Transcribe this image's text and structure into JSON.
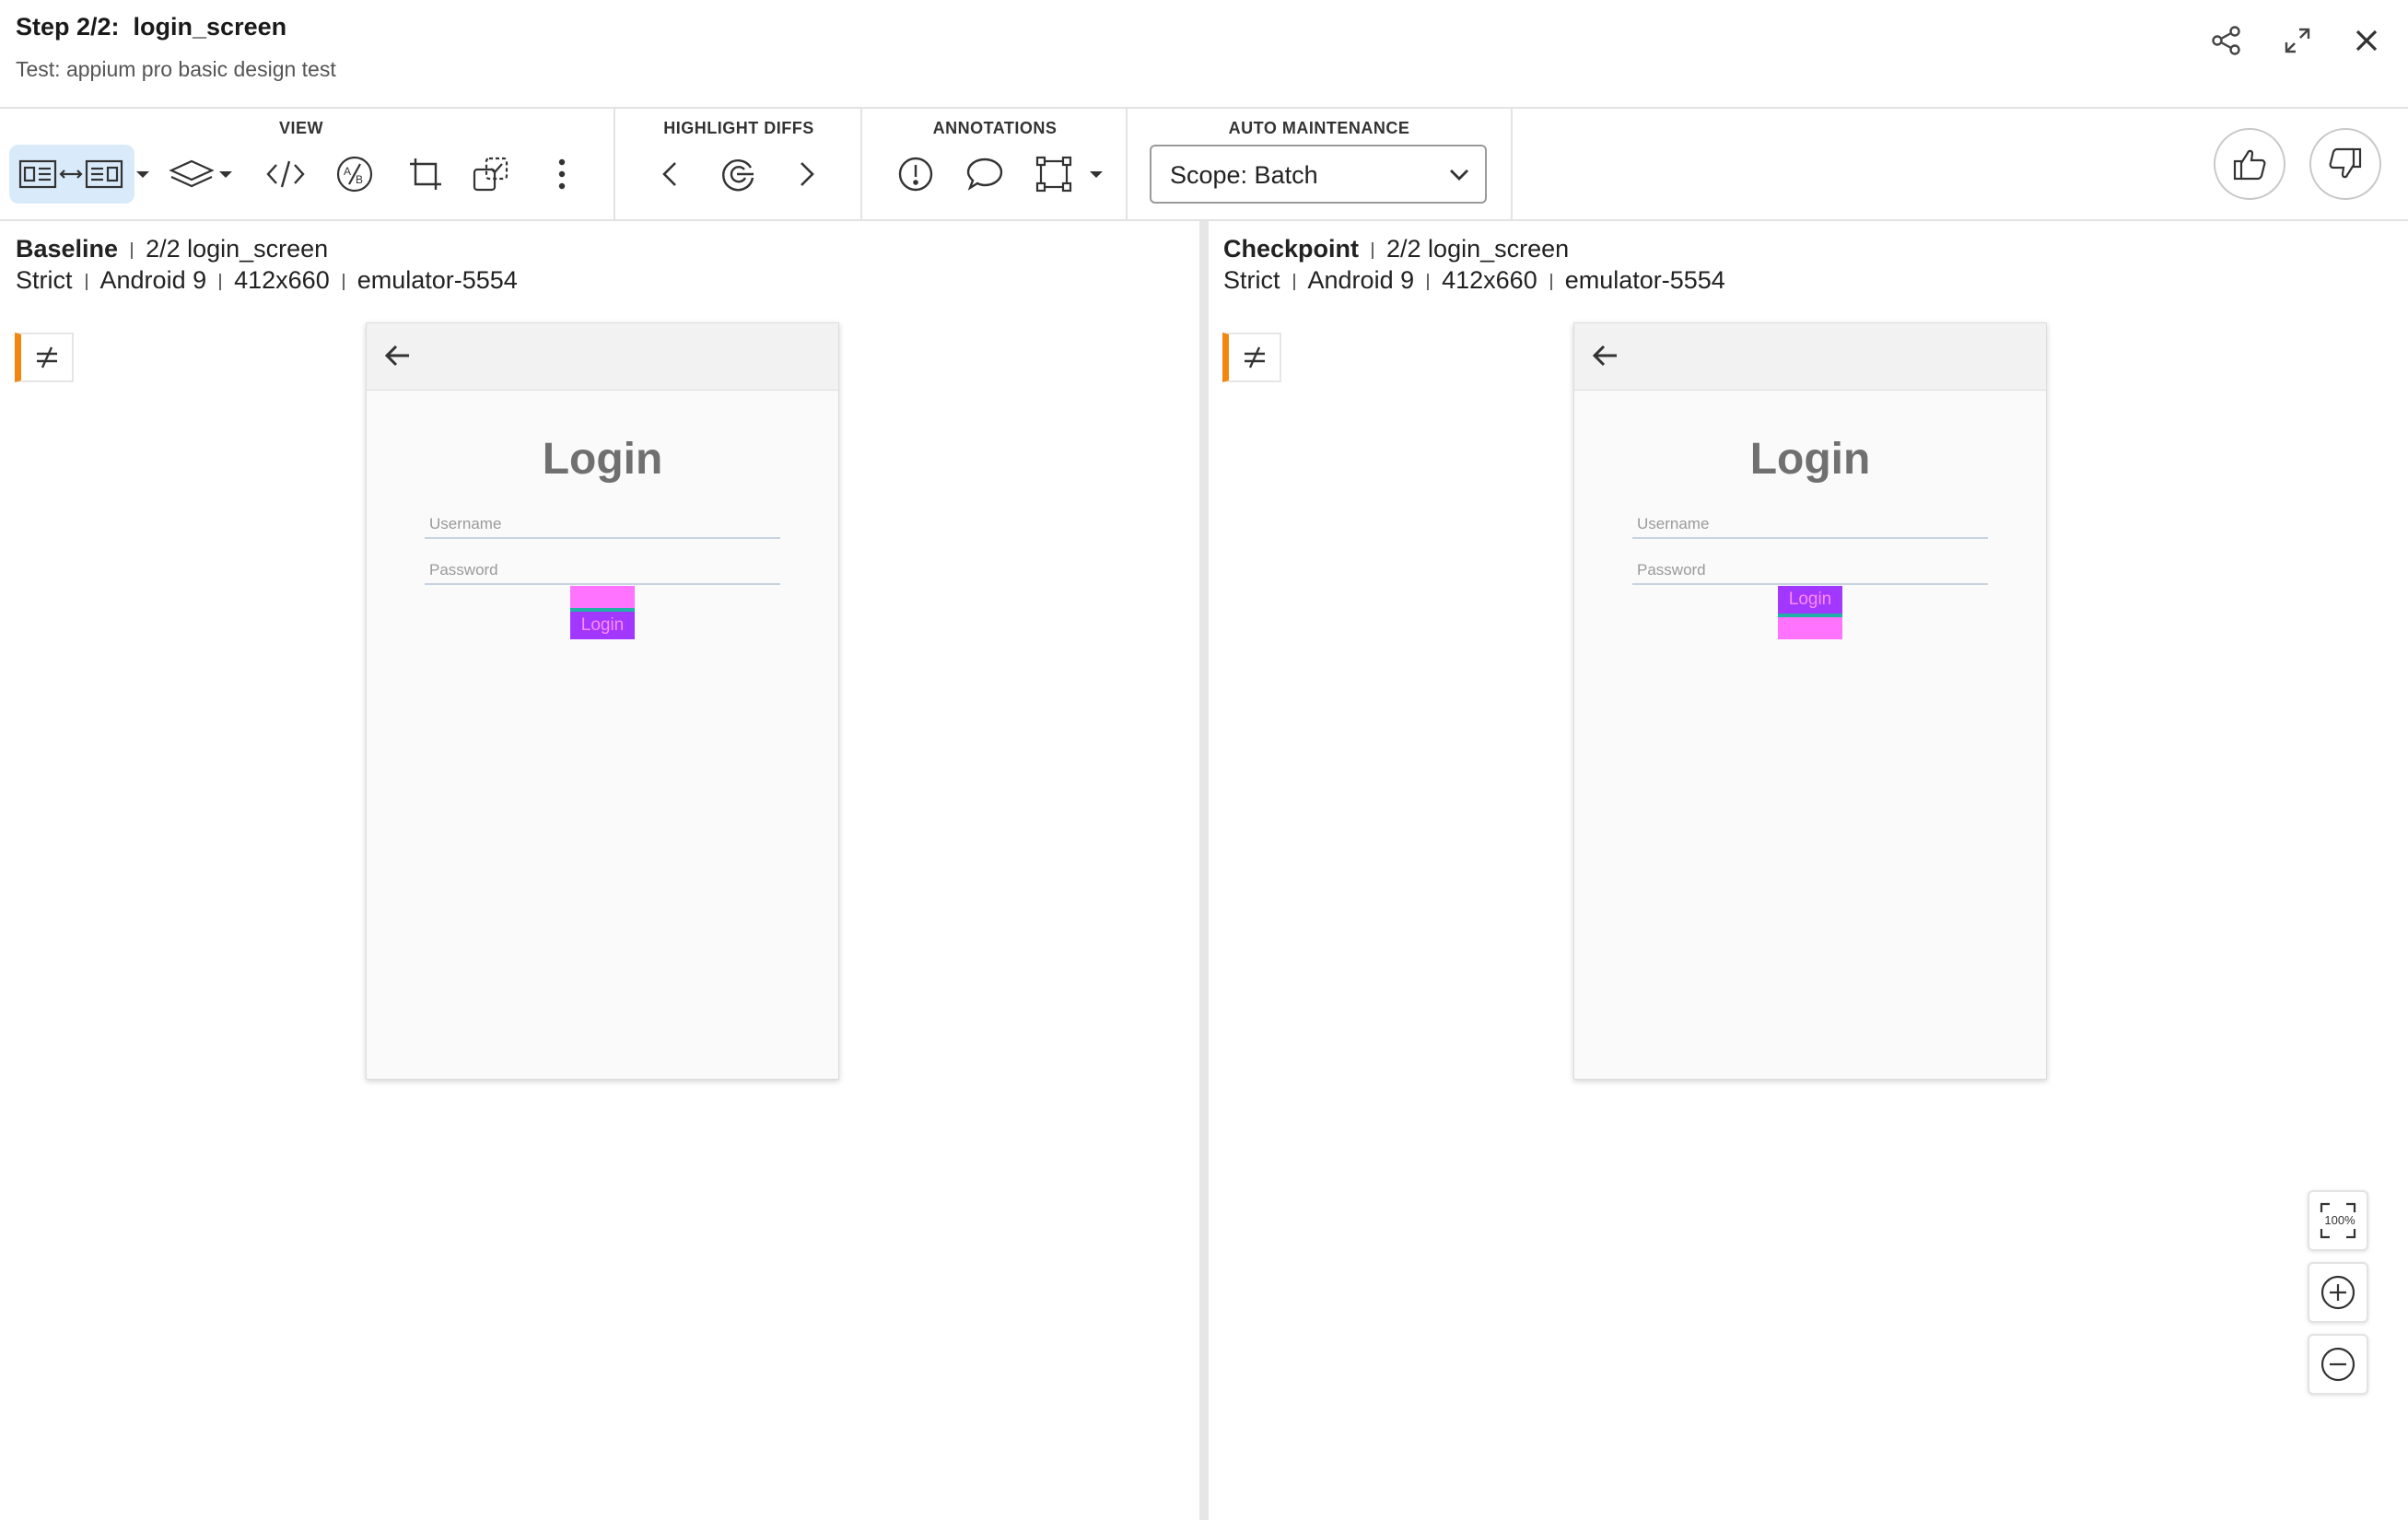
{
  "header": {
    "step_title": "Step 2/2:  login_screen",
    "test_name": "Test: appium pro basic design test"
  },
  "toolbar": {
    "view_title": "VIEW",
    "highlight_title": "HIGHLIGHT DIFFS",
    "annotations_title": "ANNOTATIONS",
    "auto_maintenance_title": "AUTO MAINTENANCE",
    "scope_value": "Scope: Batch"
  },
  "baseline": {
    "title": "Baseline",
    "step": "2/2 login_screen",
    "match_level": "Strict",
    "os": "Android 9",
    "viewport": "412x660",
    "device": "emulator-5554"
  },
  "checkpoint": {
    "title": "Checkpoint",
    "step": "2/2 login_screen",
    "match_level": "Strict",
    "os": "Android 9",
    "viewport": "412x660",
    "device": "emulator-5554"
  },
  "device_screen": {
    "title": "Login",
    "username_placeholder": "Username",
    "password_placeholder": "Password",
    "login_button": "Login"
  },
  "zoom": {
    "fit_label": "100%"
  },
  "colors": {
    "diff_highlight": "#ff73ff",
    "login_button": "#a238ff",
    "diff_flag_accent": "#f2870f",
    "active_toggle": "#d9ebfb"
  }
}
